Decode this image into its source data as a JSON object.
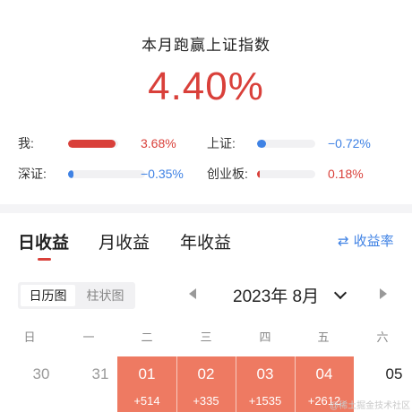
{
  "header": {
    "title": "本月跑赢上证指数",
    "value": "4.40%"
  },
  "comparisons": [
    {
      "label": "我:",
      "value": "3.68%",
      "fill": 0.95,
      "color": "#d9403a"
    },
    {
      "label": "上证:",
      "value": "−0.72%",
      "fill": 0.15,
      "color": "#3f82e4"
    },
    {
      "label": "深证:",
      "value": "−0.35%",
      "fill": 0.07,
      "color": "#3f82e4"
    },
    {
      "label": "创业板:",
      "value": "0.18%",
      "fill": 0.04,
      "color": "#d9403a"
    }
  ],
  "tabs": [
    {
      "label": "日收益",
      "active": true
    },
    {
      "label": "月收益",
      "active": false
    },
    {
      "label": "年收益",
      "active": false
    }
  ],
  "rate_toggle": {
    "icon": "swap-icon",
    "label": "收益率"
  },
  "view_toggle": {
    "options": [
      "日历图",
      "柱状图"
    ],
    "selected": "日历图"
  },
  "month": {
    "label": "2023年 8月"
  },
  "weekdays": [
    "日",
    "一",
    "二",
    "三",
    "四",
    "五",
    "六"
  ],
  "days": [
    {
      "num": "30",
      "gain": ""
    },
    {
      "num": "31",
      "gain": ""
    },
    {
      "num": "01",
      "gain": "+514"
    },
    {
      "num": "02",
      "gain": "+335"
    },
    {
      "num": "03",
      "gain": "+1535"
    },
    {
      "num": "04",
      "gain": "+2612"
    },
    {
      "num": "05",
      "gain": ""
    }
  ],
  "watermark": "@稀土掘金技术社区"
}
